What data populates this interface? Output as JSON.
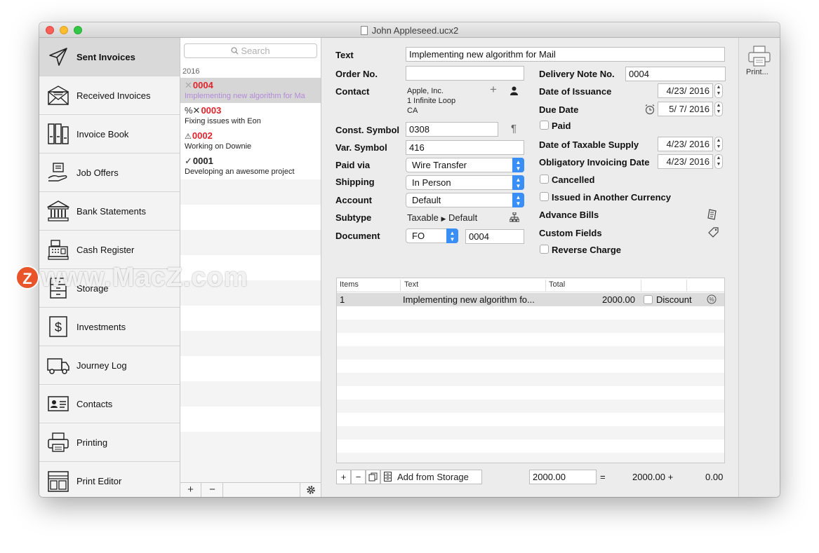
{
  "window": {
    "title": "John Appleseed.ucx2"
  },
  "sidebar": {
    "items": [
      {
        "label": "Sent Invoices",
        "icon": "paper-plane-icon",
        "active": true
      },
      {
        "label": "Received Invoices",
        "icon": "envelope-icon"
      },
      {
        "label": "Invoice Book",
        "icon": "binders-icon"
      },
      {
        "label": "Job Offers",
        "icon": "hand-offer-icon"
      },
      {
        "label": "Bank Statements",
        "icon": "bank-icon"
      },
      {
        "label": "Cash Register",
        "icon": "cash-register-icon"
      },
      {
        "label": "Storage",
        "icon": "storage-cabinet-icon"
      },
      {
        "label": "Investments",
        "icon": "dollar-icon"
      },
      {
        "label": "Journey Log",
        "icon": "truck-icon"
      },
      {
        "label": "Contacts",
        "icon": "contact-card-icon"
      },
      {
        "label": "Printing",
        "icon": "printer-icon"
      },
      {
        "label": "Print Editor",
        "icon": "layout-icon"
      }
    ]
  },
  "list": {
    "search_placeholder": "Search",
    "year": "2016",
    "invoices": [
      {
        "mark": "✕",
        "number": "0004",
        "description": "Implementing new algorithm for Ma",
        "overdue": true,
        "selected": true
      },
      {
        "mark": "%✕",
        "number": "0003",
        "description": "Fixing issues with Eon",
        "overdue": true
      },
      {
        "mark": "⚠",
        "number": "0002",
        "description": "Working on Downie",
        "overdue": true
      },
      {
        "mark": "✓",
        "number": "0001",
        "description": "Developing an awesome project",
        "overdue": false
      }
    ],
    "footer": {
      "add": "+",
      "remove": "−"
    }
  },
  "form": {
    "text_label": "Text",
    "text_value": "Implementing new algorithm for Mail",
    "order_label": "Order No.",
    "order_value": "",
    "contact_label": "Contact",
    "contact_line1": "Apple, Inc.",
    "contact_line2": "1 Infinite Loop",
    "contact_line3": "CA",
    "const_label": "Const. Symbol",
    "const_value": "0308",
    "var_label": "Var. Symbol",
    "var_value": "416",
    "paid_via_label": "Paid via",
    "paid_via_value": "Wire Transfer",
    "shipping_label": "Shipping",
    "shipping_value": "In Person",
    "account_label": "Account",
    "account_value": "Default",
    "subtype_label": "Subtype",
    "subtype_value1": "Taxable",
    "subtype_value2": "Default",
    "document_label": "Document",
    "document_type": "FO",
    "document_number": "0004",
    "delivery_label": "Delivery Note No.",
    "delivery_value": "0004",
    "issuance_label": "Date of Issuance",
    "issuance_value": "4/23/ 2016",
    "due_label": "Due Date",
    "due_value": "5/  7/ 2016",
    "paid_label": "Paid",
    "taxable_supply_label": "Date of Taxable Supply",
    "taxable_supply_value": "4/23/ 2016",
    "obligatory_label": "Obligatory Invoicing Date",
    "obligatory_value": "4/23/ 2016",
    "cancelled_label": "Cancelled",
    "currency_label": "Issued in Another Currency",
    "advance_label": "Advance Bills",
    "custom_label": "Custom Fields",
    "reverse_label": "Reverse Charge"
  },
  "items_table": {
    "headers": {
      "items": "Items",
      "text": "Text",
      "total": "Total"
    },
    "rows": [
      {
        "num": "1",
        "text": "Implementing new algorithm fo...",
        "total": "2000.00",
        "discount_label": "Discount"
      }
    ],
    "add_from_storage": "Add from Storage",
    "subtotal": "2000.00",
    "equals": "=",
    "sum_text": "2000.00 +",
    "vat": "0.00"
  },
  "toolbar": {
    "print_label": "Print..."
  },
  "watermark": {
    "logo": "Z",
    "text": "www.MacZ.com"
  },
  "colors": {
    "overdue": "#e1232b",
    "accent": "#3a8ef7",
    "selection": "#d6d6d6"
  }
}
